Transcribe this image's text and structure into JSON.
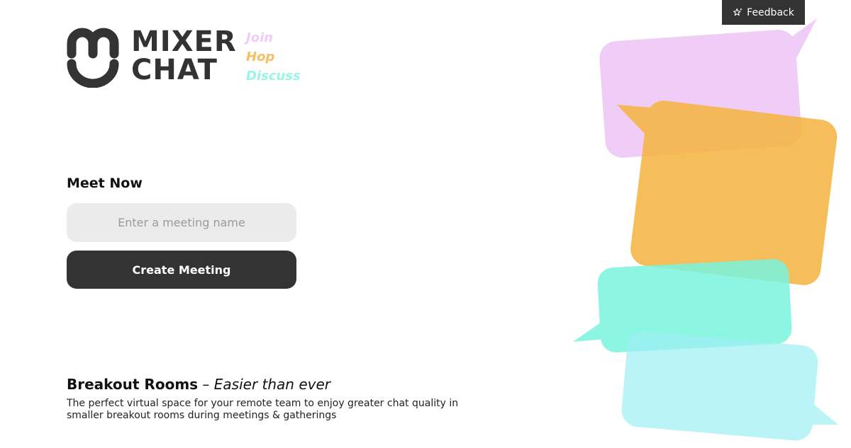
{
  "brand": {
    "line1": "MIXER",
    "line2": "CHAT",
    "tagline": [
      "Join",
      "Hop",
      "Discuss"
    ],
    "tagline_colors": [
      "#f0cbf6",
      "#f5c063",
      "#9af5e6"
    ]
  },
  "feedback": {
    "label": "Feedback",
    "icon": "sparkle-star-icon"
  },
  "meet": {
    "title": "Meet Now",
    "input_placeholder": "Enter a meeting name",
    "input_value": "",
    "create_label": "Create Meeting"
  },
  "breakout": {
    "title": "Breakout Rooms",
    "dash": "–",
    "subtitle": "Easier than ever",
    "description": "The perfect virtual space for your remote team to enjoy greater chat quality in smaller breakout rooms during meetings & gatherings"
  },
  "colors": {
    "dark": "#333333",
    "input_bg": "#ebebeb",
    "bubble_pink": "#f0cbf6",
    "bubble_orange": "#f5c063",
    "bubble_teal": "#8ef7e4",
    "bubble_light_teal": "#c2f6f8"
  }
}
